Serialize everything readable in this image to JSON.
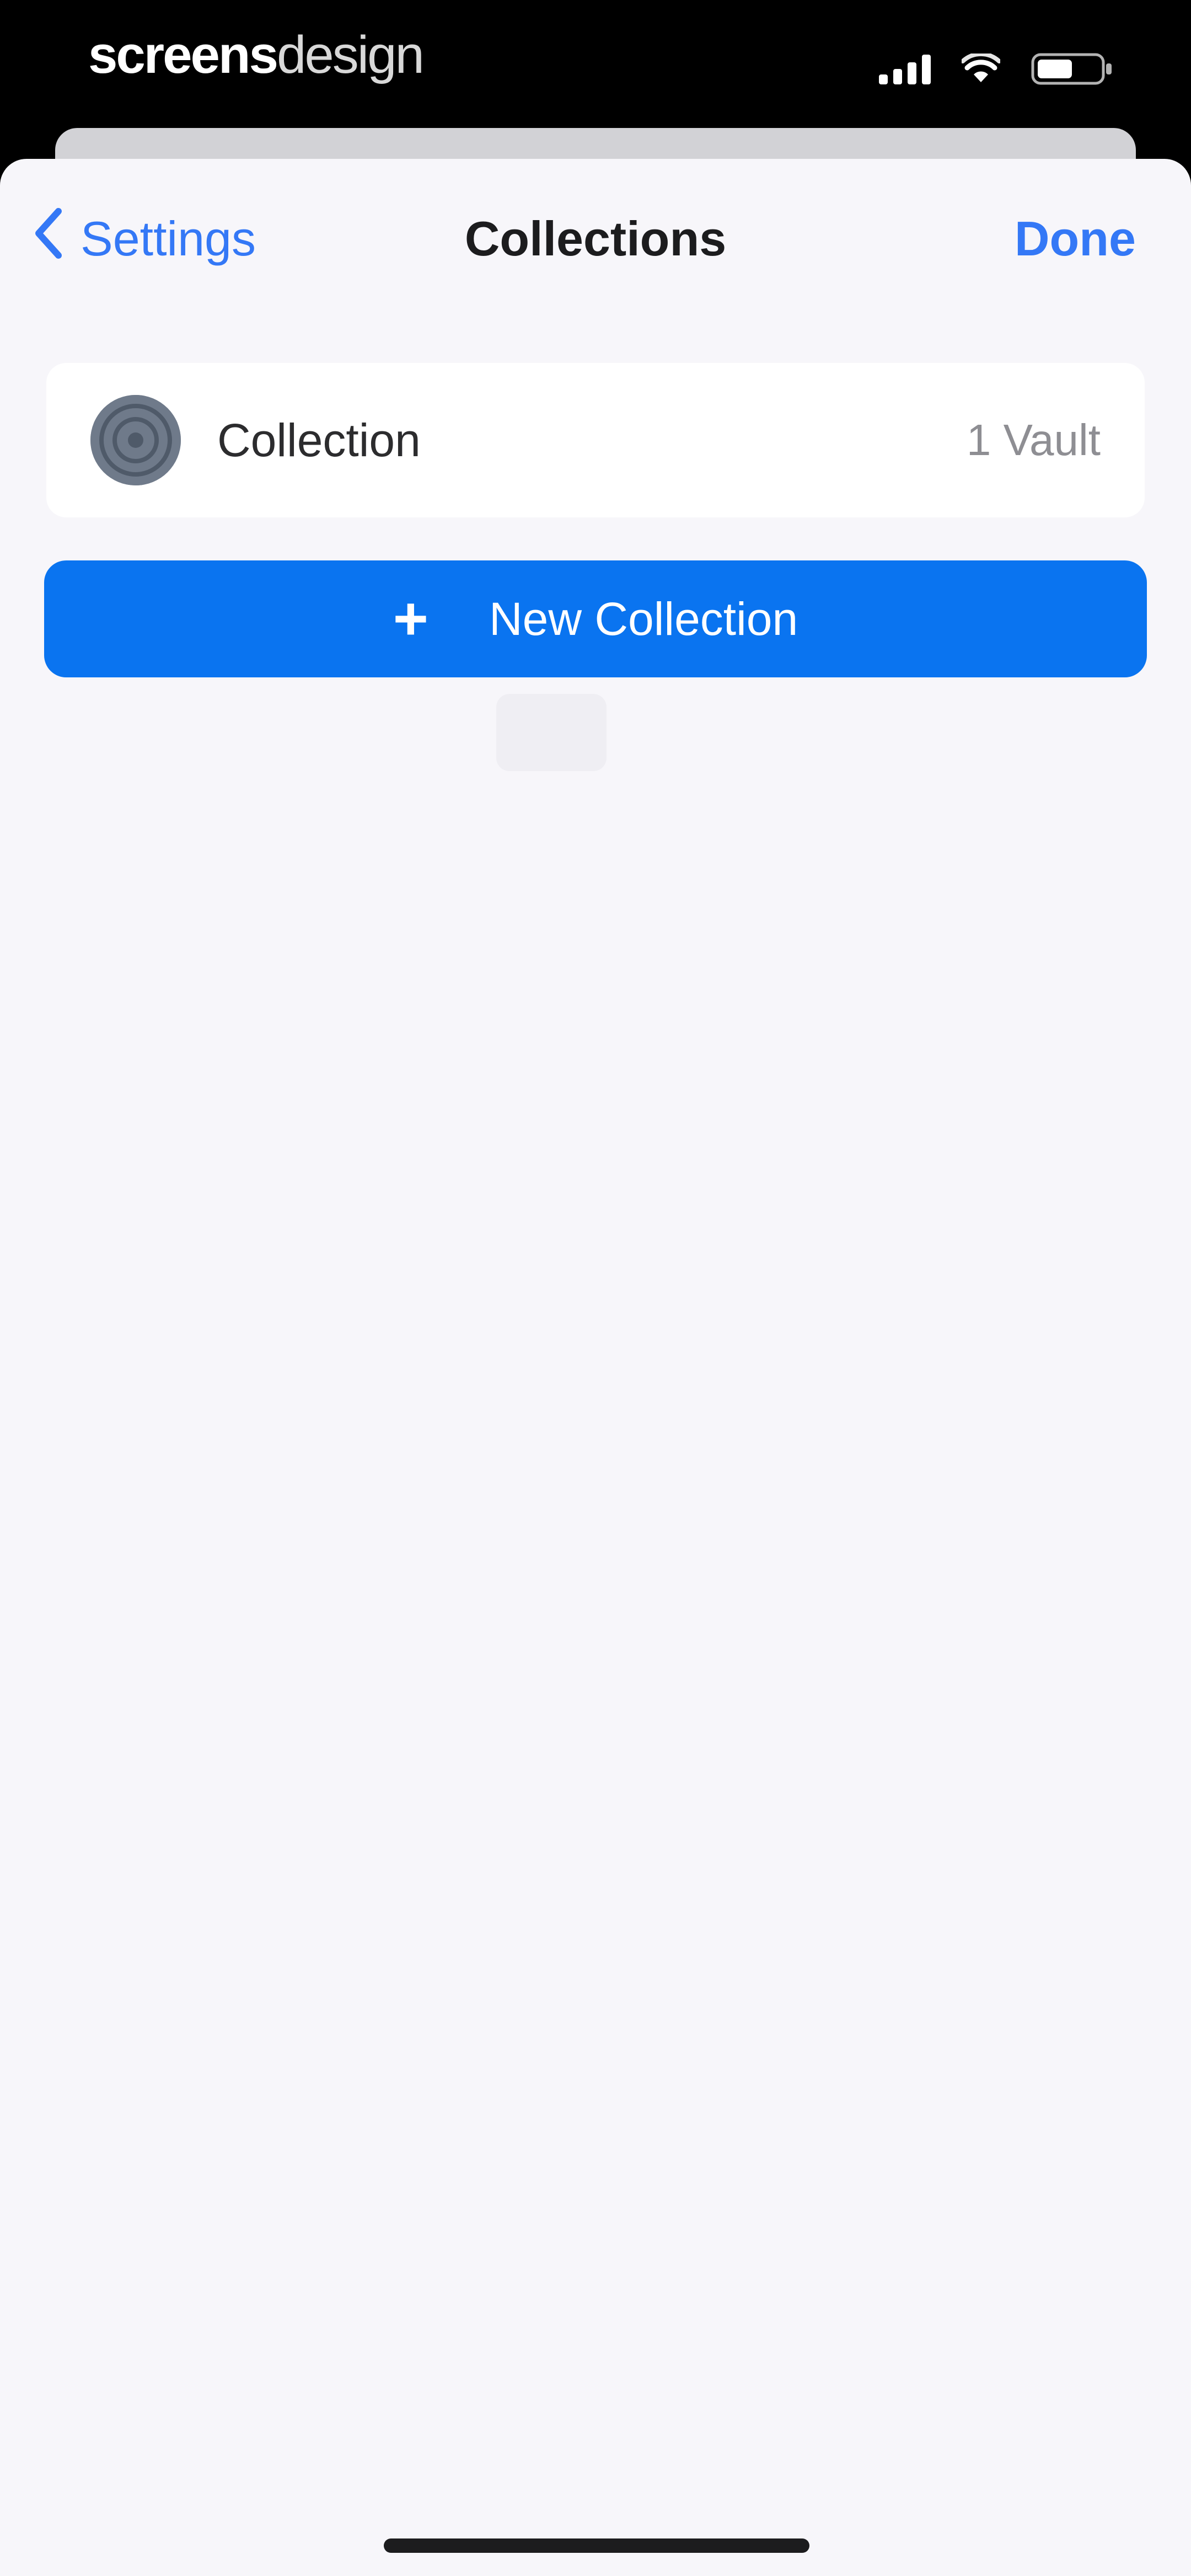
{
  "status_bar": {
    "brand_part1": "screens",
    "brand_part2": "design",
    "icons": [
      "signal-icon",
      "wifi-icon",
      "battery-icon"
    ]
  },
  "nav": {
    "back_label": "Settings",
    "title": "Collections",
    "done_label": "Done"
  },
  "collections": [
    {
      "name": "Collection",
      "count": "1 Vault",
      "icon": "collection-avatar"
    }
  ],
  "new_collection": {
    "label": "New Collection",
    "icon": "plus-icon"
  },
  "colors": {
    "accent": "#3478f6",
    "button": "#0a74f0",
    "background": "#f7f6fa"
  }
}
